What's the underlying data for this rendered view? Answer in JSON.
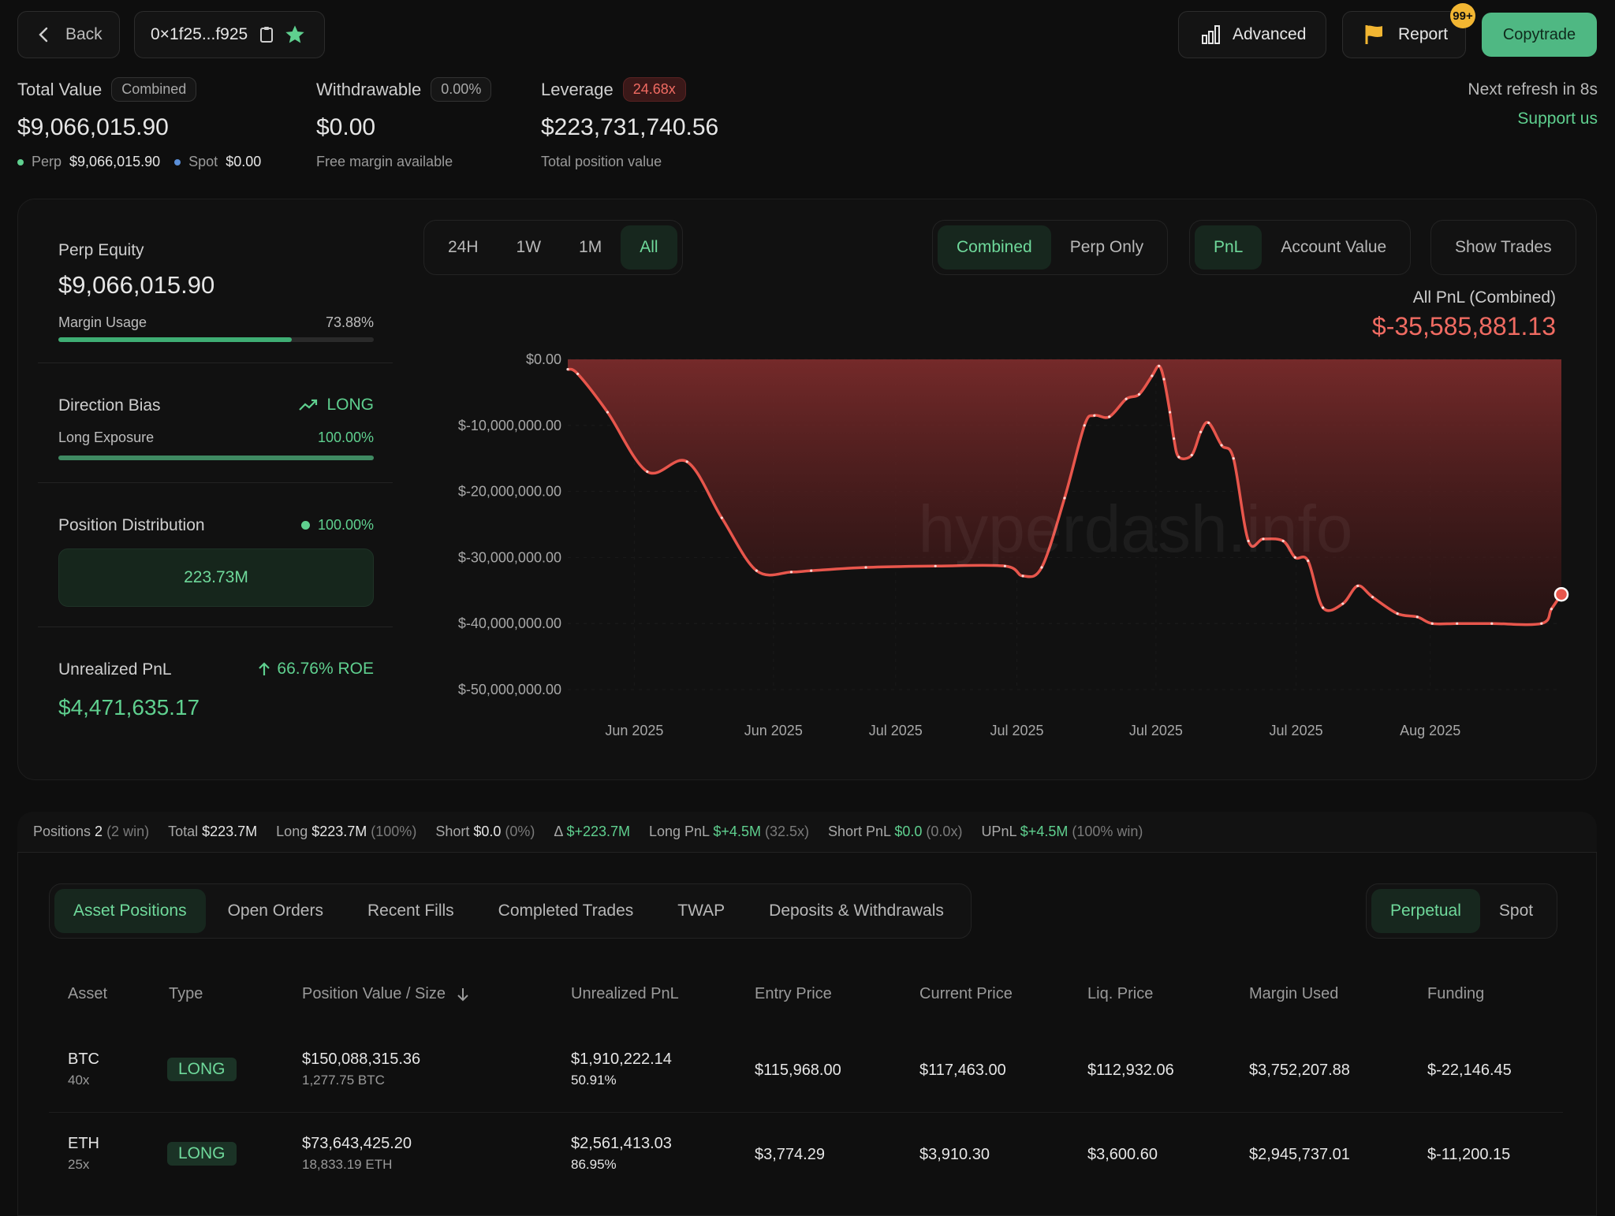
{
  "header": {
    "back_label": "Back",
    "address": "0×1f25...f925",
    "advanced_label": "Advanced",
    "report_label": "Report",
    "report_badge": "99+",
    "copytrade_label": "Copytrade"
  },
  "summary": {
    "total_value_label": "Total Value",
    "total_value_pill": "Combined",
    "total_value": "$9,066,015.90",
    "perp_label": "Perp",
    "perp_value": "$9,066,015.90",
    "spot_label": "Spot",
    "spot_value": "$0.00",
    "withdrawable_label": "Withdrawable",
    "withdrawable_pill": "0.00%",
    "withdrawable_value": "$0.00",
    "withdrawable_sub": "Free margin available",
    "leverage_label": "Leverage",
    "leverage_pill": "24.68x",
    "leverage_value": "$223,731,740.56",
    "leverage_sub": "Total position value",
    "refresh_text": "Next refresh in 8s",
    "support_label": "Support us"
  },
  "left_panel": {
    "perp_equity_label": "Perp Equity",
    "perp_equity_value": "$9,066,015.90",
    "margin_usage_label": "Margin Usage",
    "margin_usage_value": "73.88%",
    "margin_usage_fraction": 0.7388,
    "direction_label": "Direction Bias",
    "direction_value": "LONG",
    "long_exposure_label": "Long Exposure",
    "long_exposure_value": "100.00%",
    "long_exposure_fraction": 1.0,
    "position_dist_label": "Position Distribution",
    "position_dist_value": "100.00%",
    "position_dist_amount": "223.73M",
    "upnl_label": "Unrealized PnL",
    "upnl_roe": "66.76% ROE",
    "upnl_value": "$4,471,635.17"
  },
  "chart_controls": {
    "ranges": [
      "24H",
      "1W",
      "1M",
      "All"
    ],
    "active_range": "All",
    "mode_options": [
      "Combined",
      "Perp Only"
    ],
    "metric_options": [
      "PnL",
      "Account Value"
    ],
    "show_trades_label": "Show Trades"
  },
  "chart_data": {
    "type": "area",
    "title": "All PnL (Combined)",
    "headline_value": "$-35,585,881.13",
    "watermark": "hyperdash.info",
    "ylim": [
      -50000000,
      0
    ],
    "y_ticks": [
      0,
      -10000000,
      -20000000,
      -30000000,
      -40000000,
      -50000000
    ],
    "y_tick_labels": [
      "$0.00",
      "$-10,000,000.00",
      "$-20,000,000.00",
      "$-30,000,000.00",
      "$-40,000,000.00",
      "$-50,000,000.00"
    ],
    "x_tick_labels": [
      "Jun 2025",
      "Jun 2025",
      "Jul 2025",
      "Jul 2025",
      "Jul 2025",
      "Jul 2025",
      "Aug 2025"
    ],
    "x_tick_positions": [
      0.067,
      0.207,
      0.33,
      0.452,
      0.592,
      0.733,
      0.868
    ],
    "series": [
      {
        "x": [
          0,
          0.01,
          0.04,
          0.08,
          0.12,
          0.155,
          0.19,
          0.225,
          0.245,
          0.3,
          0.37,
          0.44,
          0.458,
          0.477,
          0.5,
          0.52,
          0.53,
          0.545,
          0.562,
          0.575,
          0.588,
          0.595,
          0.6,
          0.606,
          0.61,
          0.615,
          0.628,
          0.637,
          0.645,
          0.658,
          0.67,
          0.685,
          0.7,
          0.72,
          0.732,
          0.745,
          0.76,
          0.78,
          0.795,
          0.81,
          0.835,
          0.855,
          0.87,
          0.895,
          0.93,
          0.98,
          0.99,
          1.0
        ],
        "y": [
          -1500000,
          -2200000,
          -8000000,
          -17000000,
          -15500000,
          -24000000,
          -32000000,
          -32200000,
          -32000000,
          -31500000,
          -31300000,
          -31300000,
          -32800000,
          -31500000,
          -21000000,
          -10000000,
          -8500000,
          -8700000,
          -6000000,
          -5300000,
          -2500000,
          -1000000,
          -3000000,
          -8000000,
          -12000000,
          -14800000,
          -14500000,
          -11000000,
          -9600000,
          -13000000,
          -15000000,
          -27500000,
          -27200000,
          -27500000,
          -30000000,
          -30500000,
          -37600000,
          -37000000,
          -34300000,
          -36000000,
          -38500000,
          -39000000,
          -40000000,
          -40000000,
          -40000000,
          -40000000,
          -37800000,
          -35585881
        ]
      }
    ],
    "grid": true,
    "line_color": "#e8564c",
    "fill_color": "#6e2b2b"
  },
  "positions_bar": {
    "items": [
      {
        "label": "Positions",
        "value": "2",
        "extra": "(2 win)"
      },
      {
        "label": "Total",
        "value": "$223.7M",
        "extra": ""
      },
      {
        "label": "Long",
        "value": "$223.7M",
        "extra": "(100%)"
      },
      {
        "label": "Short",
        "value": "$0.0",
        "extra": "(0%)"
      },
      {
        "label": "Δ",
        "value": "$+223.7M",
        "extra": ""
      },
      {
        "label": "Long PnL",
        "value": "$+4.5M",
        "extra": "(32.5x)"
      },
      {
        "label": "Short PnL",
        "value": "$0.0",
        "extra": "(0.0x)"
      },
      {
        "label": "UPnL",
        "value": "$+4.5M",
        "extra": "(100% win)"
      }
    ]
  },
  "tabs": {
    "items": [
      "Asset Positions",
      "Open Orders",
      "Recent Fills",
      "Completed Trades",
      "TWAP",
      "Deposits & Withdrawals"
    ],
    "active": "Asset Positions",
    "market_options": [
      "Perpetual",
      "Spot"
    ],
    "active_market": "Perpetual"
  },
  "table": {
    "headers": [
      "Asset",
      "Type",
      "Position Value / Size",
      "Unrealized PnL",
      "Entry Price",
      "Current Price",
      "Liq. Price",
      "Margin Used",
      "Funding"
    ],
    "rows": [
      {
        "asset": "BTC",
        "leverage": "40x",
        "type": "LONG",
        "value": "$150,088,315.36",
        "size": "1,277.75 BTC",
        "upnl": "$1,910,222.14",
        "upnl_pct": "50.91%",
        "entry": "$115,968.00",
        "current": "$117,463.00",
        "liq": "$112,932.06",
        "margin": "$3,752,207.88",
        "funding": "$-22,146.45"
      },
      {
        "asset": "ETH",
        "leverage": "25x",
        "type": "LONG",
        "value": "$73,643,425.20",
        "size": "18,833.19 ETH",
        "upnl": "$2,561,413.03",
        "upnl_pct": "86.95%",
        "entry": "$3,774.29",
        "current": "$3,910.30",
        "liq": "$3,600.60",
        "margin": "$2,945,737.01",
        "funding": "$-11,200.15"
      }
    ]
  },
  "colors": {
    "accent_green": "#5fd08f",
    "negative_red": "#f06b62",
    "copytrade_bg": "#4fb883",
    "badge_yellow": "#f2b632"
  }
}
